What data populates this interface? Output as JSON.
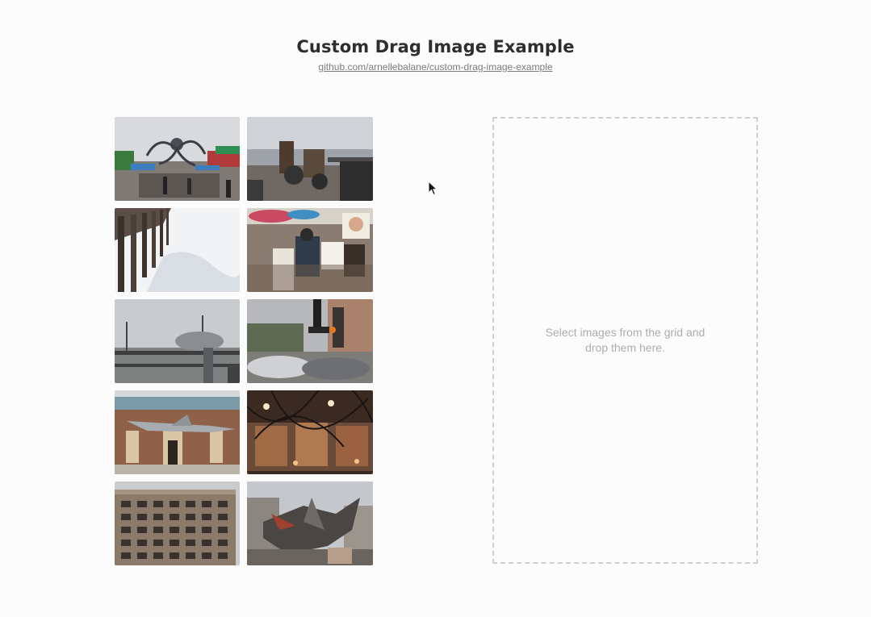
{
  "header": {
    "title": "Custom Drag Image Example",
    "repo_link": "github.com/arnellebalane/custom-drag-image-example"
  },
  "grid": {
    "images": [
      {
        "name": "pier-octopus-ride"
      },
      {
        "name": "pier-drummer-band"
      },
      {
        "name": "pier-pilings-waves"
      },
      {
        "name": "caricature-artist"
      },
      {
        "name": "pier-binocular-viewer"
      },
      {
        "name": "street-traffic-light"
      },
      {
        "name": "museum-jet-facade"
      },
      {
        "name": "bookstore-wire-sculpture"
      },
      {
        "name": "office-building"
      },
      {
        "name": "scrap-metal-sculpture"
      }
    ]
  },
  "drop_zone": {
    "hint": "Select images from the grid and drop them here."
  },
  "icons": {
    "cursor": "mouse-pointer-icon"
  }
}
